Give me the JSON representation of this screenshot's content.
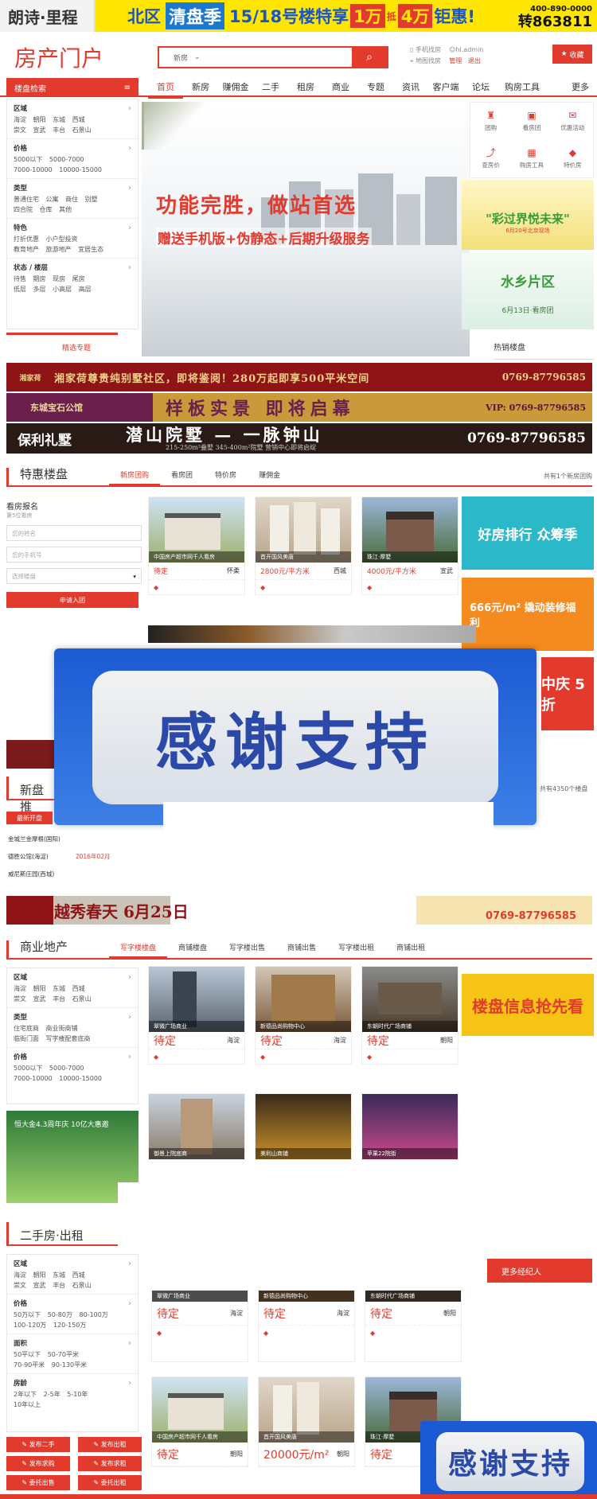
{
  "top_ad": {
    "logo": "朗诗·里程",
    "area": "北区",
    "highlight": "清盘季",
    "text": "15/18号楼特享",
    "wan1": "1万",
    "di": "抵",
    "wan2": "4万",
    "end": "钜惠!",
    "phone_small": "400-890-0000",
    "phone_big": "转863811"
  },
  "header": {
    "brand": "房产门户",
    "search_category": "新房",
    "search_placeholder": "",
    "links": [
      "手机找房",
      "地图找房"
    ],
    "user_links": [
      "hl.admin",
      "管理",
      "退出"
    ],
    "collect_label": "收藏"
  },
  "nav": {
    "category_title": "楼盘检索",
    "items": [
      "首页",
      "新房",
      "赚佣金",
      "二手",
      "租房",
      "商业",
      "专题",
      "资讯",
      "客户端",
      "论坛",
      "购房工具"
    ],
    "more": "更多"
  },
  "left_categories": [
    {
      "title": "区域",
      "rows": [
        "海淀 朝阳 东城 西城",
        "崇文 宣武 丰台 石景山"
      ]
    },
    {
      "title": "价格",
      "rows": [
        "5000以下 5000-7000",
        "7000-10000 10000-15000"
      ]
    },
    {
      "title": "类型",
      "rows": [
        "普通住宅 公寓 商住 别墅",
        "四合院 仓库 其他"
      ]
    },
    {
      "title": "特色",
      "rows": [
        "打折优惠 小户型投资",
        "教育地产 旅游地产 宜居生态"
      ]
    },
    {
      "title": "状态 / 楼层",
      "rows": [
        "待售 期房 现房 尾房",
        "低层 多层 小高层 高层"
      ]
    }
  ],
  "featured_special_label": "精选专题",
  "banner": {
    "line1": "功能完胜，做站首选",
    "line2": "赠送手机版+伪静态+后期升级服务"
  },
  "quick_nav": [
    "团购",
    "看房团",
    "优惠活动",
    "查房价",
    "购房工具",
    "特价房"
  ],
  "side_ads": {
    "ad1": "\"彩过界悦未来\"",
    "ad1_sub": "6月20号北京现场",
    "ad2": "水乡片区",
    "ad2_sub": "6月13日·看房团",
    "hot_label": "热销楼盘"
  },
  "ad_strips": [
    {
      "name": "湘家荷",
      "text": "湘家荷尊贵纯别墅社区，即将鉴阅！280万起即享500平米空间",
      "phone": "0769-87796585"
    },
    {
      "name": "东城宝石公馆",
      "text": "样板实景 即将启幕",
      "phone": "VIP: 0769-87796585"
    },
    {
      "name": "保利礼墅",
      "text": "潜山院墅 — 一脉钟山",
      "sub": "215-250m²叠墅 345-400m²院墅 营销中心即将启绽",
      "phone": "0769-87796585"
    }
  ],
  "special": {
    "title": "特惠楼盘",
    "tabs": [
      "新房团购",
      "看房团",
      "特价房",
      "赚佣金"
    ],
    "right": "共有1个新房团购",
    "form": {
      "title": "看房报名",
      "sub": "第5位看房",
      "name": "您的姓名",
      "phone": "您的手机号",
      "select": "选择楼盘",
      "submit": "申请入团"
    },
    "cards": [
      {
        "caption": "中国房产超市网千人看房",
        "price": "待定",
        "loc": "怀柔"
      },
      {
        "caption": "首开国风美唐",
        "price": "2800元/平方米",
        "loc": "西城"
      },
      {
        "caption": "珠江·摩墅",
        "price": "4000元/平方米",
        "loc": "宣武"
      }
    ],
    "promo1": "好房排行 众筹季",
    "promo2": "666元/m² 撬动装修福利",
    "promo3": "中庆 5折"
  },
  "overlay_text": "感谢支持",
  "newsection": {
    "title": "新盘推",
    "right": "共有4350个楼盘",
    "label": "最新开盘",
    "rows": [
      "金城兰金摩根(国阳)",
      "德胜公馆(海淀)",
      "威尼斯庄园(西城)"
    ],
    "date": "2016年02月",
    "ad_text": "越秀春天 6月25日",
    "ad_phone": "0769-87796585"
  },
  "commercial": {
    "title": "商业地产",
    "tabs": [
      "写字楼楼盘",
      "商铺楼盘",
      "写字楼出售",
      "商铺出售",
      "写字楼出租",
      "商铺出租"
    ],
    "cats": [
      {
        "title": "区域",
        "rows": [
          "海淀 朝阳 东城 西城",
          "崇文 宣武 丰台 石景山"
        ]
      },
      {
        "title": "类型",
        "rows": [
          "住宅底商 商业街商铺",
          "临街门面 写字楼配套底商"
        ]
      },
      {
        "title": "价格",
        "rows": [
          "5000以下 5000-7000",
          "7000-10000 10000-15000"
        ]
      }
    ],
    "cards": [
      {
        "caption": "翠微广场商业",
        "price": "待定",
        "loc": "海淀"
      },
      {
        "caption": "新德品尚购物中心",
        "price": "待定",
        "loc": "海淀"
      },
      {
        "caption": "东朝时代广场商铺",
        "price": "待定",
        "loc": "朝阳"
      },
      {
        "caption": "御景上院底商",
        "price": "",
        "loc": ""
      },
      {
        "caption": "美利山商铺",
        "price": "",
        "loc": ""
      },
      {
        "caption": "苹果22院街",
        "price": "",
        "loc": ""
      }
    ],
    "promo": "楼盘信息抢先看",
    "ad_banner": "恒大金4.3周年庆 10亿大惠邀"
  },
  "secondhand": {
    "title": "二手房·出租",
    "more_agents": "更多经纪人",
    "cats": [
      {
        "title": "区域",
        "rows": [
          "海淀 朝阳 东城 西城",
          "崇文 宣武 丰台 石景山"
        ]
      },
      {
        "title": "价格",
        "rows": [
          "50万以下 50-80万 80-100万",
          "100-120万 120-150万"
        ]
      },
      {
        "title": "面积",
        "rows": [
          "50平以下 50-70平米",
          "70-90平米 90-130平米"
        ]
      },
      {
        "title": "房龄",
        "rows": [
          "2年以下 2-5年 5-10年",
          "10年以上"
        ]
      }
    ],
    "buttons": [
      "发布二手",
      "发布出租",
      "发布求购",
      "发布求租",
      "委托出售",
      "委托出租"
    ],
    "cards": [
      {
        "caption": "翠微广场商业",
        "price": "待定",
        "loc": "海淀"
      },
      {
        "caption": "新德品尚购物中心",
        "price": "待定",
        "loc": "海淀"
      },
      {
        "caption": "东朝时代广场商铺",
        "price": "待定",
        "loc": "朝阳"
      },
      {
        "caption": "中国房产超市网千人看房",
        "price": "待定",
        "loc": "朝阳"
      },
      {
        "caption": "首开国风美唐",
        "price": "20000元/m²",
        "loc": "朝阳"
      },
      {
        "caption": "珠江·摩墅",
        "price": "待定",
        "loc": ""
      }
    ]
  }
}
